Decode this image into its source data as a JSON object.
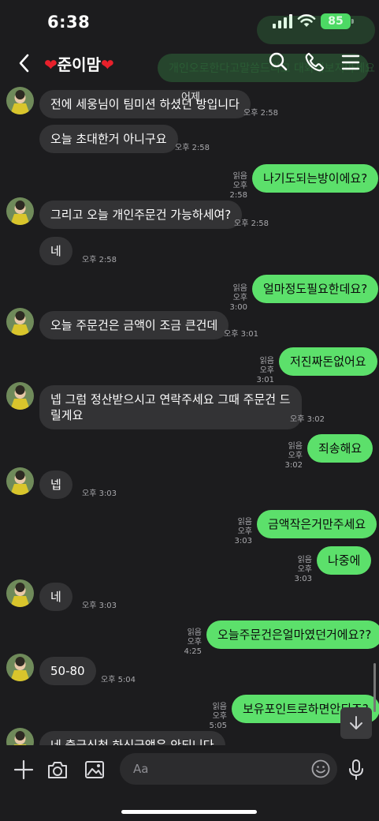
{
  "status_bar": {
    "time": "6:38",
    "battery": "85"
  },
  "header": {
    "title": "준이맘",
    "icons": [
      "back-icon",
      "heart-icon",
      "search-icon",
      "phone-icon",
      "menu-icon"
    ]
  },
  "ghost_text": "개인오로한다고말씀드리고 대화해보지마세요",
  "date_peek": "어제",
  "messages": [
    {
      "side": "in",
      "text": "전에 세웅님이 팀미션 하셨던 방입니다",
      "time": "오후 2:58"
    },
    {
      "side": "in",
      "text": "오늘 초대한거 아니구요",
      "time": "오후 2:58"
    },
    {
      "side": "out",
      "text": "나기도되는방이에요?",
      "read": "읽음",
      "time": "오후 2:58"
    },
    {
      "side": "in",
      "text": "그리고 오늘 개인주문건 가능하세여?",
      "time": "오후 2:58"
    },
    {
      "side": "in",
      "text": "네",
      "time": "오후 2:58"
    },
    {
      "side": "out",
      "text": "얼마정도필요한데요?",
      "read": "읽음",
      "time": "오후 3:00"
    },
    {
      "side": "in",
      "text": "오늘 주문건은 금액이 조금 큰건데",
      "time": "오후 3:01"
    },
    {
      "side": "out",
      "text": "저진짜돈없어요",
      "read": "읽음",
      "time": "오후 3:01"
    },
    {
      "side": "in",
      "text_line1": "넵 그럼 정산받으시고  연락주세요 그때 주문건 드",
      "text_line2": "릴게요",
      "time": "오후 3:02"
    },
    {
      "side": "out",
      "text": "죄송해요",
      "read": "읽음",
      "time": "오후 3:02"
    },
    {
      "side": "in",
      "text": "넵",
      "time": "오후 3:03"
    },
    {
      "side": "out",
      "text": "금액작은거만주세요",
      "read": "읽음",
      "time": "오후 3:03"
    },
    {
      "side": "out",
      "text": "나중에",
      "read": "읽음",
      "time": "오후 3:03"
    },
    {
      "side": "in",
      "text": "네",
      "time": "오후 3:03"
    },
    {
      "side": "out",
      "text": "오늘주문건은얼마였던거에요??",
      "read": "읽음",
      "time": "오후 4:25"
    },
    {
      "side": "in",
      "text": "50-80",
      "time": "오후 5:04"
    },
    {
      "side": "out",
      "text": "보유포인트로하면안되죠?",
      "read": "읽음",
      "time": "오후 5:05"
    },
    {
      "side": "in",
      "text": "네 출금신청 하신금액은 안되니다"
    }
  ],
  "input": {
    "placeholder": "Aa",
    "icons": [
      "plus-icon",
      "camera-icon",
      "gallery-icon",
      "emoji-icon",
      "mic-icon"
    ]
  },
  "colors": {
    "background": "#1c1c1e",
    "incoming_bubble": "#333335",
    "outgoing_bubble": "#5ce06b",
    "meta_text": "#a9a9ad",
    "battery": "#4cd964",
    "heart": "#e8202b"
  }
}
